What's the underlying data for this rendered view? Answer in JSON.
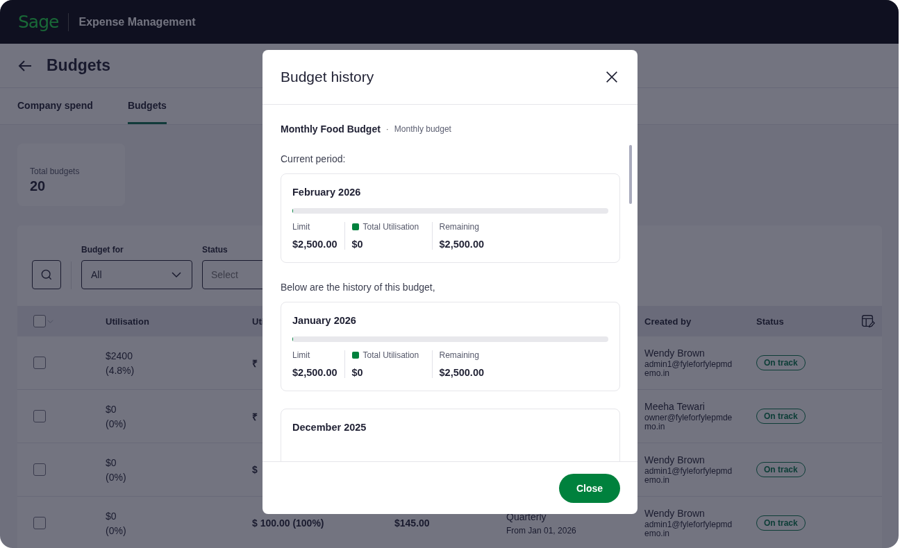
{
  "app": {
    "logo": "Sage",
    "title": "Expense Management"
  },
  "page": {
    "title": "Budgets"
  },
  "tabs": [
    {
      "label": "Company spend",
      "selected": false
    },
    {
      "label": "Budgets",
      "selected": true
    }
  ],
  "summary": {
    "label": "Total budgets",
    "value": "20"
  },
  "filters": [
    {
      "label": "Budget for",
      "kind": "dropdown",
      "value": "All"
    },
    {
      "label": "Status",
      "kind": "select",
      "placeholder": "Select"
    }
  ],
  "table": {
    "select_all": {
      "checked": false
    },
    "columns": [
      "Utilisation",
      "Uti",
      "Created by",
      "Status"
    ],
    "rows": [
      {
        "checked": false,
        "utilisation": "$2400",
        "utilisation_pct": "(4.8%)",
        "column_3": "₹",
        "created_by": "Wendy Brown",
        "email": "admin1@fyleforfylepmdemo.in",
        "status": "On track"
      },
      {
        "checked": false,
        "utilisation": "$0",
        "utilisation_pct": "(0%)",
        "column_3": "₹",
        "created_by": "Meeha Tewari",
        "email": "owner@fyleforfylepmdemo.in",
        "status": "On track"
      },
      {
        "checked": false,
        "utilisation": "$0",
        "utilisation_pct": "(0%)",
        "column_3": "$",
        "created_by": "Wendy Brown",
        "email": "admin1@fyleforfylepmdemo.in",
        "status": "On track"
      },
      {
        "checked": false,
        "utilisation": "$0",
        "utilisation_pct": "(0%)",
        "column_3": "$ 100.00 (100%)",
        "column_4": "$145.00",
        "column_5": [
          "Quarterly",
          "From Jan 01, 2026"
        ],
        "created_by": "Wendy Brown",
        "email": "admin1@fyleforfylepmdemo.in",
        "status": "On track"
      }
    ]
  },
  "modal": {
    "title": "Budget history",
    "budget_name": "Monthly Food Budget",
    "separator": "·",
    "budget_type": "Monthly budget",
    "current_label": "Current period:",
    "current": {
      "period": "February 2026",
      "level": 0,
      "stats": [
        {
          "label": "Limit",
          "value": "$2,500.00"
        },
        {
          "label": "Total Utilisation",
          "value": "$0",
          "kind": "legend",
          "color": "#00813d"
        },
        {
          "label": "Remaining",
          "value": "$2,500.00"
        }
      ]
    },
    "history_label": "Below are the history of this budget,",
    "history": [
      {
        "period": "January 2026",
        "level": 0,
        "stats": [
          {
            "label": "Limit",
            "value": "$2,500.00"
          },
          {
            "label": "Total Utilisation",
            "value": "$0",
            "kind": "legend",
            "color": "#00813d"
          },
          {
            "label": "Remaining",
            "value": "$2,500.00"
          }
        ]
      },
      {
        "period": "December 2025"
      }
    ],
    "button": "Close"
  }
}
